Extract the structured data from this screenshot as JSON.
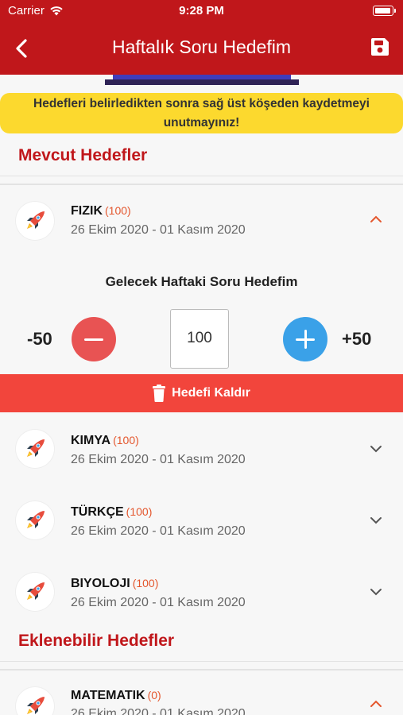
{
  "status": {
    "carrier": "Carrier",
    "time": "9:28 PM"
  },
  "nav": {
    "title": "Haftalık Soru Hedefim"
  },
  "notice": {
    "line1": "Hedefleri belirledikten sonra sağ üst köşeden kaydetmeyi",
    "line2": "unutmayınız!"
  },
  "current": {
    "heading": "Mevcut Hedefler",
    "items": [
      {
        "subject": "FIZIK",
        "count": "(100)",
        "date": "26 Ekim 2020 - 01 Kasım 2020"
      },
      {
        "subject": "KIMYA",
        "count": "(100)",
        "date": "26 Ekim 2020 - 01 Kasım 2020"
      },
      {
        "subject": "TÜRKÇE",
        "count": "(100)",
        "date": "26 Ekim 2020 - 01 Kasım 2020"
      },
      {
        "subject": "BIYOLOJI",
        "count": "(100)",
        "date": "26 Ekim 2020 - 01 Kasım 2020"
      }
    ]
  },
  "editor": {
    "title": "Gelecek Haftaki Soru Hedefim",
    "minus_label": "-50",
    "plus_label": "+50",
    "value": "100",
    "remove_label": "Hedefi Kaldır"
  },
  "available": {
    "heading": "Eklenebilir Hedefler",
    "items": [
      {
        "subject": "MATEMATIK",
        "count": "(0)",
        "date": "26 Ekim 2020 - 01 Kasım 2020"
      }
    ]
  },
  "colors": {
    "primary": "#c0171b",
    "notice": "#fcd92e",
    "remove": "#f2453c",
    "minus": "#e85353",
    "plus": "#3aa1e8",
    "count": "#e4572e"
  }
}
